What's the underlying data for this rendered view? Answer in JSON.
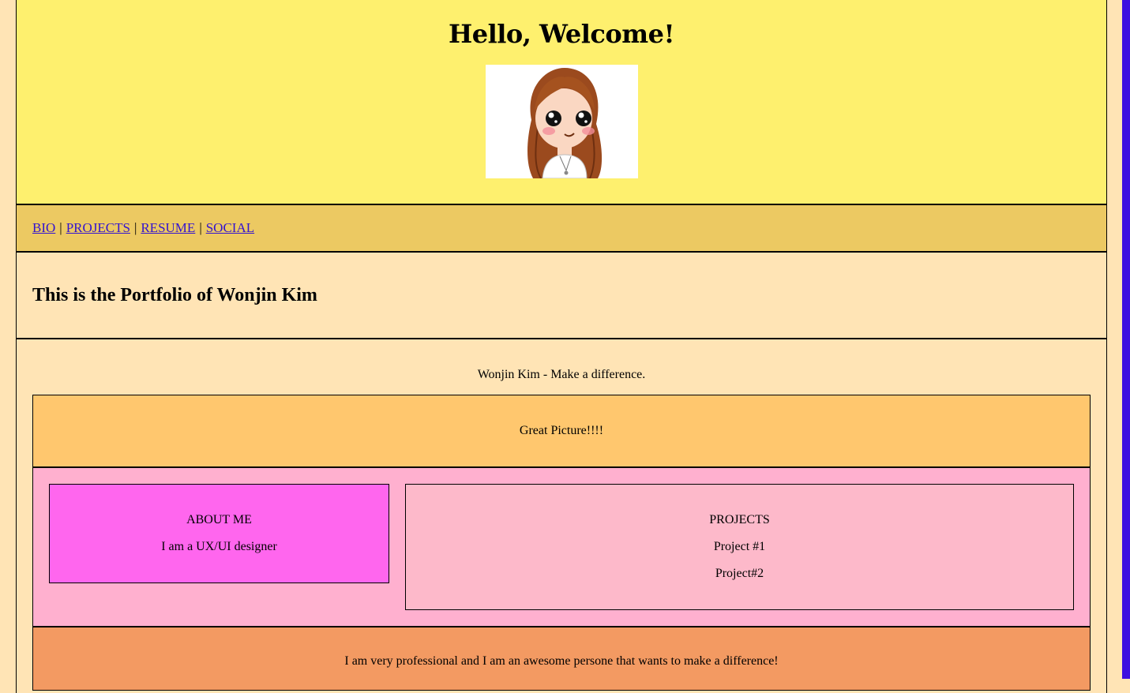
{
  "header": {
    "title": "Hello, Welcome!"
  },
  "nav": {
    "items": [
      "BIO",
      "PROJECTS",
      "RESUME",
      "SOCIAL"
    ],
    "separator": "|"
  },
  "portfolio_title": "This is the Portfolio of Wonjin Kim",
  "tagline": "Wonjin Kim - Make a difference.",
  "great_picture": "Great Picture!!!!",
  "about": {
    "heading": "ABOUT ME",
    "text": "I am a UX/UI designer"
  },
  "projects": {
    "heading": "PROJECTS",
    "items": [
      "Project #1",
      "Project#2"
    ]
  },
  "closing": "I am very professional and I am an awesome persone that wants to make a difference!",
  "colors": {
    "page_bg": "#FFE4B5",
    "header_bg": "#FEF06E",
    "nav_bg": "#ECC962",
    "great_bg": "#FFC76E",
    "row_bg": "#FFB0CF",
    "about_bg": "#FF66EE",
    "projects_bg": "#FDB9CA",
    "closing_bg": "#F39A62",
    "link": "#3313D0",
    "scrollbar": "#3D0FE0"
  }
}
